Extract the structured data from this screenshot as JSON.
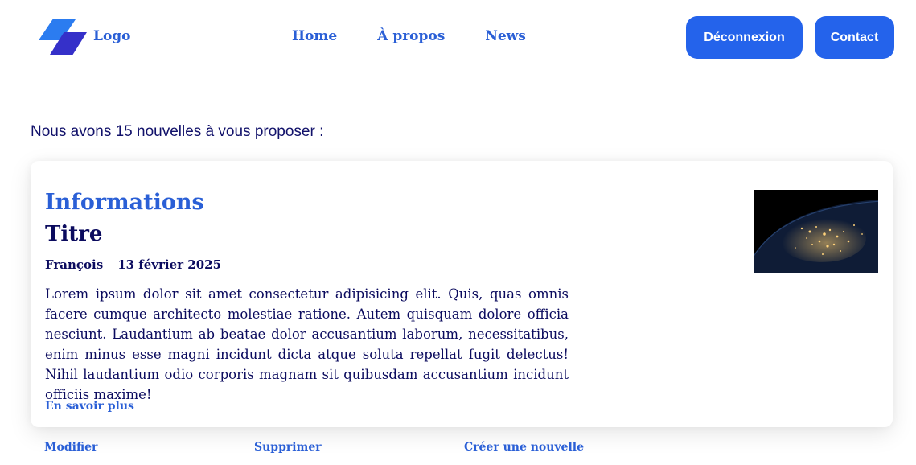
{
  "header": {
    "logo_label": "Logo",
    "nav": [
      "Home",
      "À propos",
      "News"
    ],
    "logout_label": "Déconnexion",
    "contact_label": "Contact"
  },
  "intro_text": "Nous avons 15 nouvelles à vous proposer :",
  "article": {
    "category": "Informations",
    "title": "Titre",
    "author": "François",
    "date": "13 février 2025",
    "body": "Lorem ipsum dolor sit amet consectetur adipisicing elit. Quis, quas omnis facere cumque architecto molestiae ratione. Autem quisquam dolore officia nesciunt. Laudantium ab beatae dolor accusantium laborum, necessitatibus, enim minus esse magni incidunt dicta atque soluta repellat fugit delectus! Nihil laudantium odio corporis magnam sit quibusdam accusantium incidunt officiis maxime!",
    "more_label": "En savoir plus",
    "image_icon": "earth-at-night-image"
  },
  "actions": {
    "edit_label": "Modifier",
    "delete_label": "Supprimer",
    "create_label": "Créer une nouvelle"
  },
  "colors": {
    "accent": "#2a5fd6",
    "button": "#2463eb",
    "text": "#0b0b5e"
  }
}
